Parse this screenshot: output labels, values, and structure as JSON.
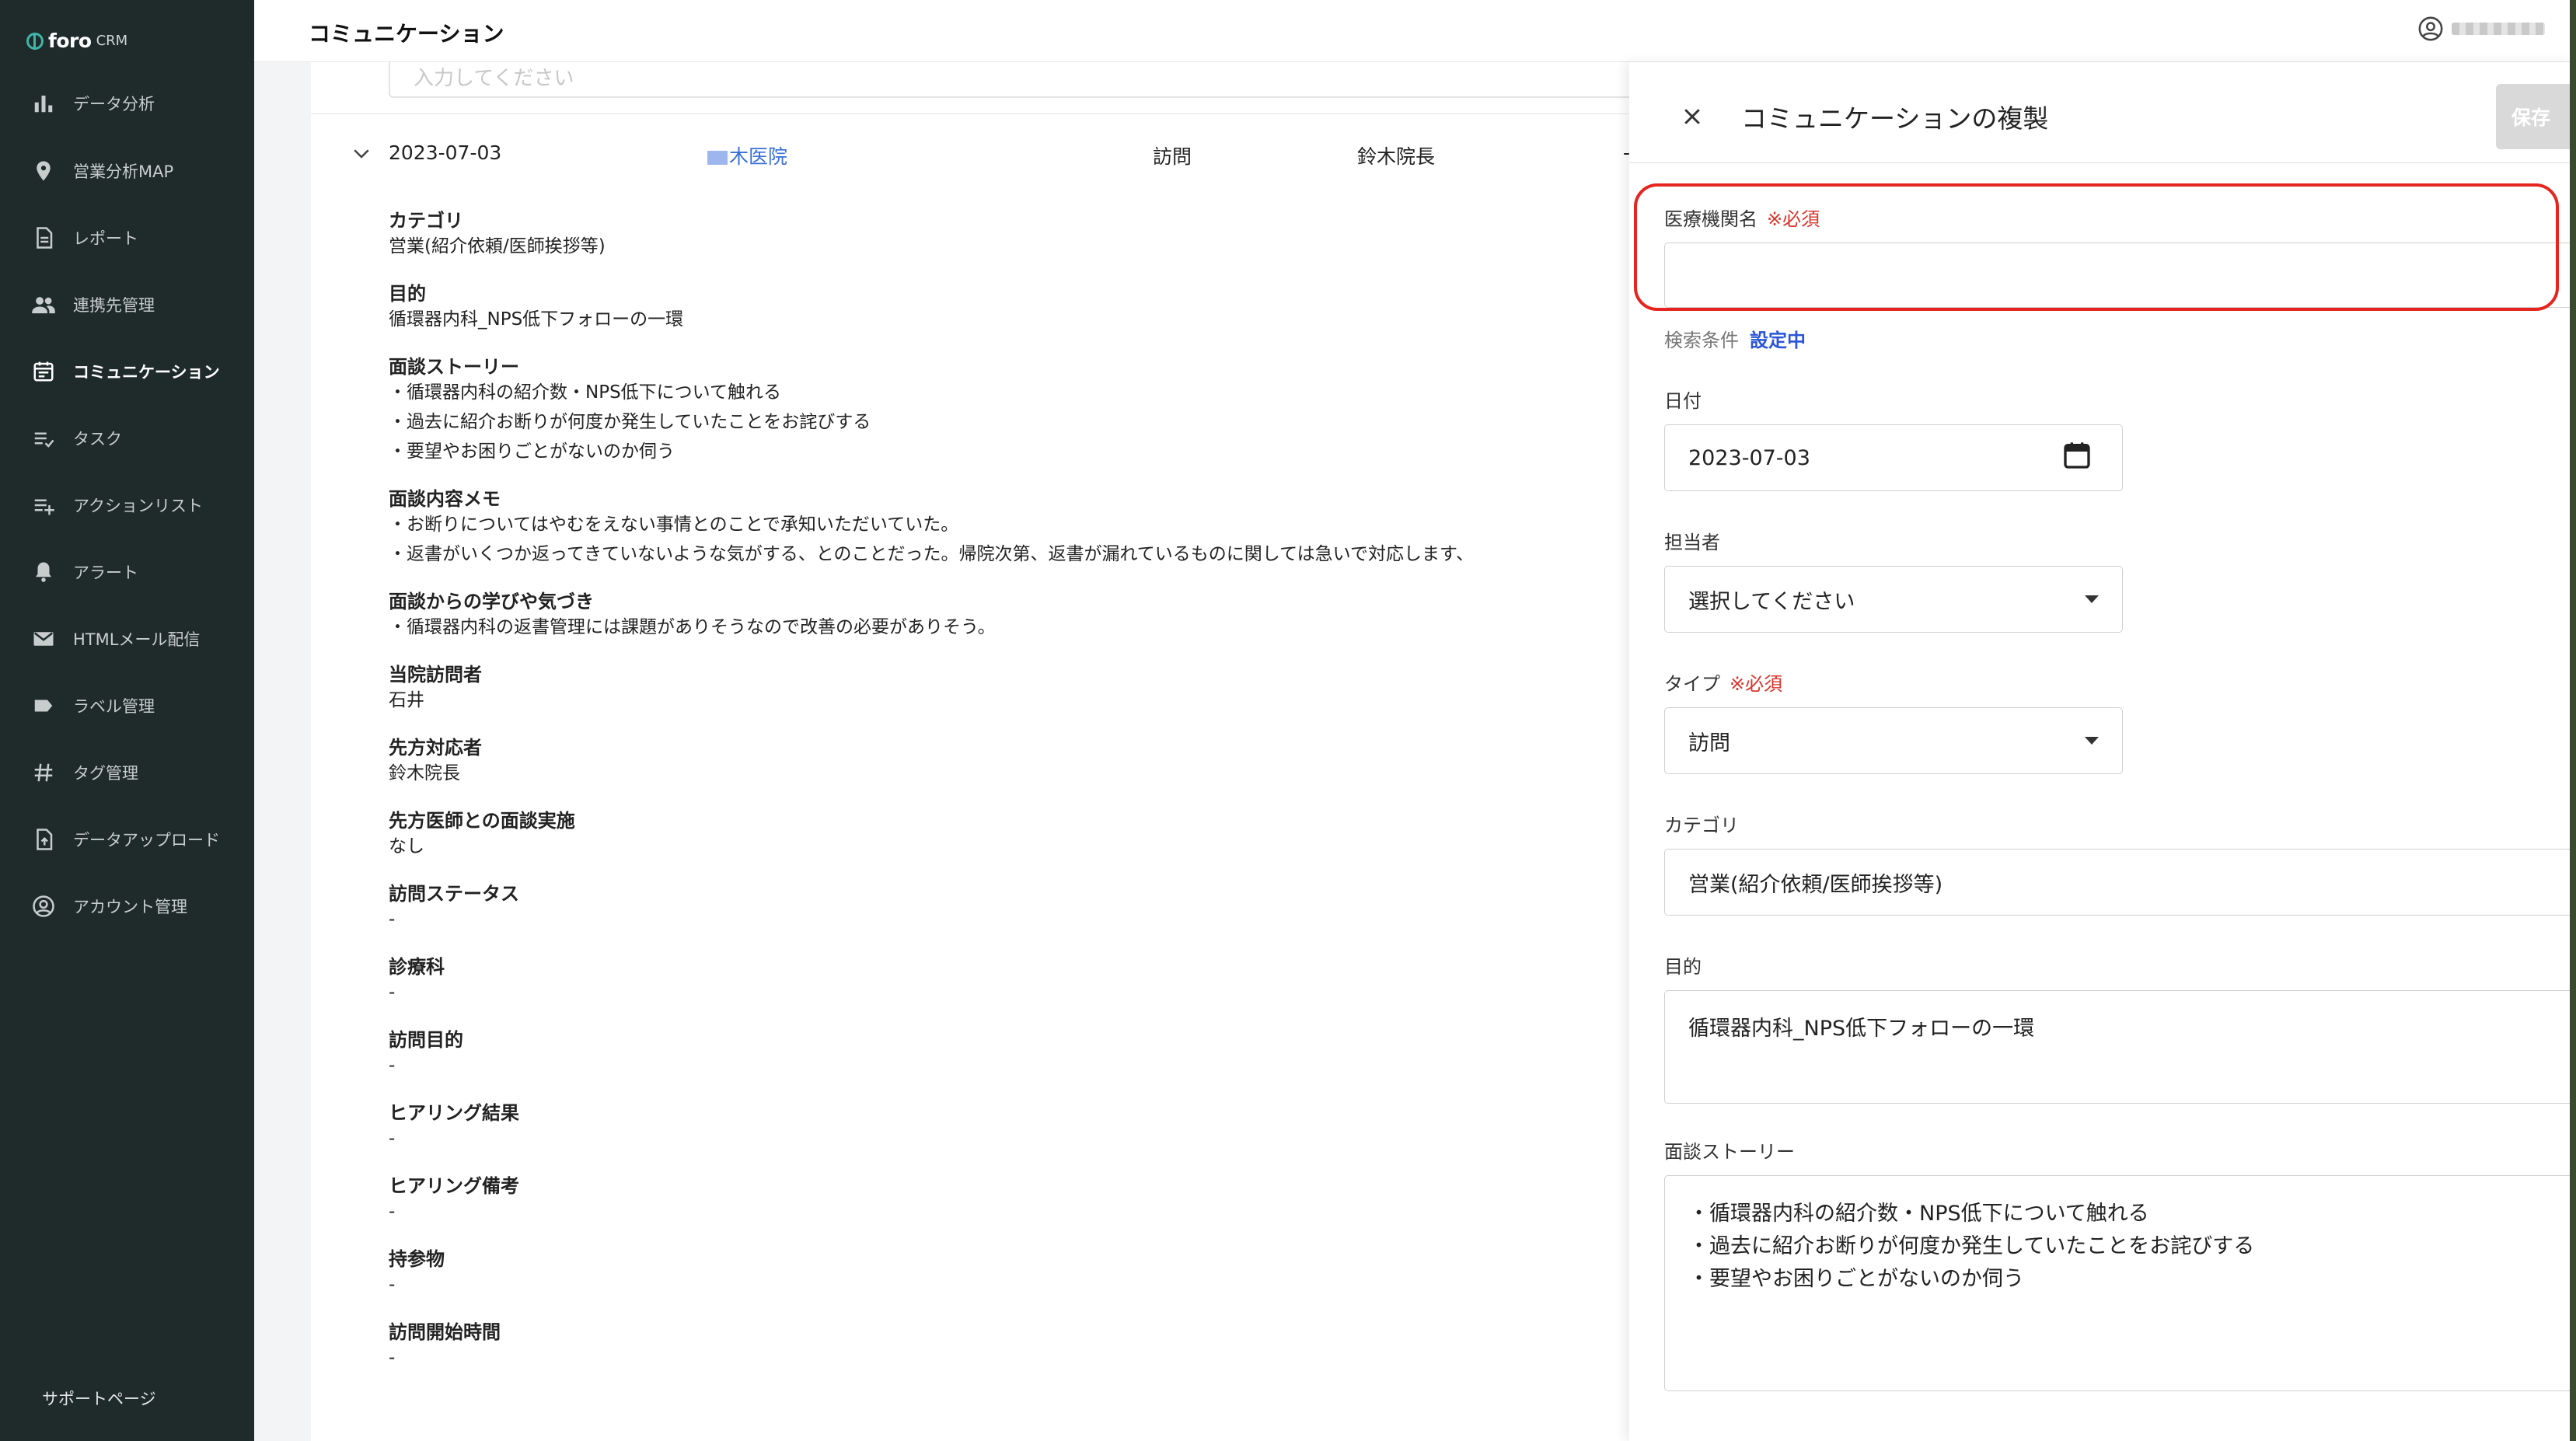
{
  "app": {
    "logo_text": "foro",
    "logo_sub": "CRM",
    "page_title": "コミュニケーション",
    "support_link": "サポートページ"
  },
  "sidebar": {
    "items": [
      {
        "label": "データ分析",
        "icon": "bar-chart-icon"
      },
      {
        "label": "営業分析MAP",
        "icon": "map-pin-icon"
      },
      {
        "label": "レポート",
        "icon": "document-icon"
      },
      {
        "label": "連携先管理",
        "icon": "people-icon"
      },
      {
        "label": "コミュニケーション",
        "icon": "calendar-icon",
        "active": true
      },
      {
        "label": "タスク",
        "icon": "task-list-icon"
      },
      {
        "label": "アクションリスト",
        "icon": "playlist-add-icon"
      },
      {
        "label": "アラート",
        "icon": "bell-icon"
      },
      {
        "label": "HTMLメール配信",
        "icon": "mail-icon"
      },
      {
        "label": "ラベル管理",
        "icon": "label-icon"
      },
      {
        "label": "タグ管理",
        "icon": "hash-icon"
      },
      {
        "label": "データアップロード",
        "icon": "upload-file-icon"
      },
      {
        "label": "アカウント管理",
        "icon": "account-circle-icon"
      }
    ]
  },
  "record": {
    "date": "2023-07-03",
    "clinic": "木医院",
    "type": "訪問",
    "person": "鈴木院長",
    "trailing": "-",
    "fields": [
      {
        "label": "カテゴリ",
        "value": "営業(紹介依頼/医師挨拶等)"
      },
      {
        "label": "目的",
        "value": "循環器内科_NPS低下フォローの一環"
      },
      {
        "label": "面談ストーリー",
        "value": "・循環器内科の紹介数・NPS低下について触れる\n・過去に紹介お断りが何度か発生していたことをお詫びする\n・要望やお困りごとがないのか伺う"
      },
      {
        "label": "面談内容メモ",
        "value": "・お断りについてはやむをえない事情とのことで承知いただいていた。\n・返書がいくつか返ってきていないような気がする、とのことだった。帰院次第、返書が漏れているものに関しては急いで対応します、"
      },
      {
        "label": "面談からの学びや気づき",
        "value": "・循環器内科の返書管理には課題がありそうなので改善の必要がありそう。"
      },
      {
        "label": "当院訪問者",
        "value": "石井"
      },
      {
        "label": "先方対応者",
        "value": "鈴木院長"
      },
      {
        "label": "先方医師との面談実施",
        "value": "なし"
      },
      {
        "label": "訪問ステータス",
        "value": "-"
      },
      {
        "label": "診療科",
        "value": "-"
      },
      {
        "label": "訪問目的",
        "value": "-"
      },
      {
        "label": "ヒアリング結果",
        "value": "-"
      },
      {
        "label": "ヒアリング備考",
        "value": "-"
      },
      {
        "label": "持参物",
        "value": "-"
      },
      {
        "label": "訪問開始時間",
        "value": "-"
      }
    ]
  },
  "panel": {
    "title": "コミュニケーションの複製",
    "save_label": "保存",
    "required_mark": "※必須",
    "clinic_label": "医療機関名",
    "clinic_value": "",
    "search_cond_label": "検索条件",
    "search_cond_value": "設定中",
    "date_label": "日付",
    "date_value": "2023-07-03",
    "owner_label": "担当者",
    "owner_value": "選択してください",
    "type_label": "タイプ",
    "type_value": "訪問",
    "category_label": "カテゴリ",
    "category_value": "営業(紹介依頼/医師挨拶等)",
    "purpose_label": "目的",
    "purpose_value": "循環器内科_NPS低下フォローの一環",
    "story_label": "面談ストーリー",
    "story_value": "・循環器内科の紹介数・NPS低下について触れる\n・過去に紹介お断りが何度か発生していたことをお詫びする\n・要望やお困りごとがないのか伺う"
  },
  "search_placeholder": "入力してください"
}
